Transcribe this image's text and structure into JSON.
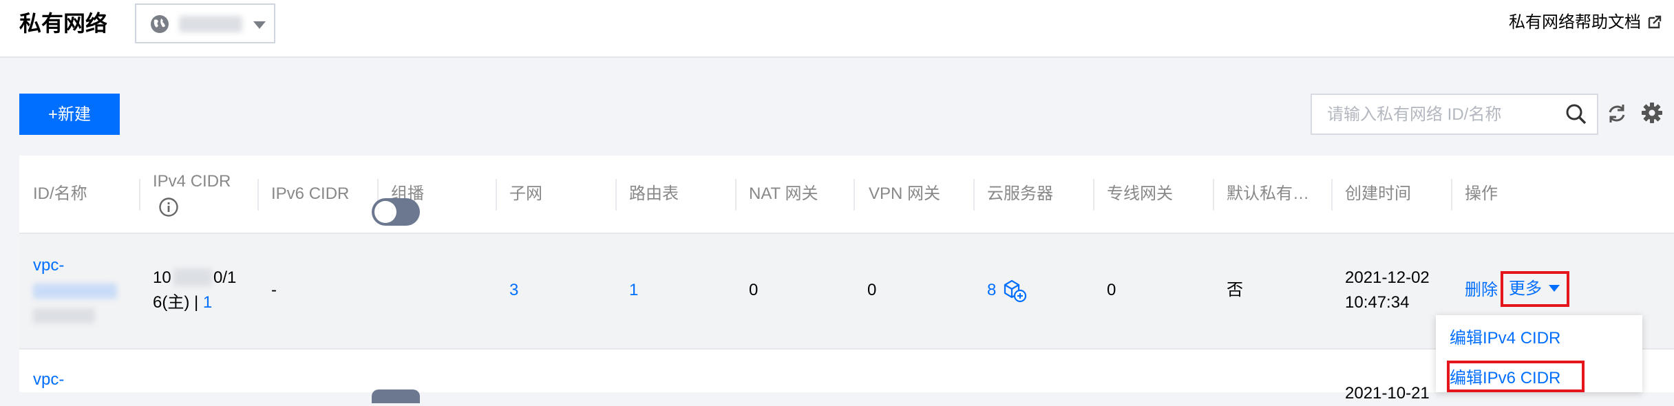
{
  "header": {
    "title": "私有网络",
    "help_link": "私有网络帮助文档"
  },
  "toolbar": {
    "new_button": "+新建",
    "search_placeholder": "请输入私有网络 ID/名称"
  },
  "table": {
    "columns": [
      "ID/名称",
      "IPv4 CIDR",
      "IPv6 CIDR",
      "组播",
      "子网",
      "路由表",
      "NAT 网关",
      "VPN 网关",
      "云服务器",
      "专线网关",
      "默认私有…",
      "创建时间",
      "操作"
    ],
    "rows": [
      {
        "id_prefix": "vpc-",
        "ipv4_line1_start": "10",
        "ipv4_line1_end": "0/1",
        "ipv4_line2": "6(主) | ",
        "ipv4_count": "1",
        "ipv6": "-",
        "multicast_on": false,
        "subnets": "3",
        "route_tables": "1",
        "nat": "0",
        "vpn": "0",
        "cvm": "8",
        "dc_gateway": "0",
        "default": "否",
        "created_date": "2021-12-02",
        "created_time": "10:47:34",
        "action_delete": "删除",
        "action_more": "更多"
      },
      {
        "id_prefix": "vpc-",
        "created_date": "2021-10-21"
      }
    ]
  },
  "dropdown": {
    "items": [
      "编辑IPv4 CIDR",
      "编辑IPv6 CIDR"
    ]
  },
  "colors": {
    "accent": "#006eff",
    "highlight": "#e4161b"
  }
}
